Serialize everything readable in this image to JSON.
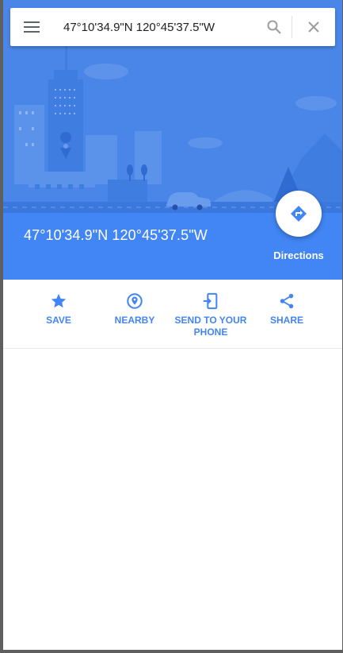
{
  "search": {
    "query": "47°10'34.9\"N 120°45'37.5\"W",
    "menu_icon": "hamburger-menu-icon",
    "search_icon": "magnifier-icon",
    "close_icon": "close-icon"
  },
  "place": {
    "title": "47°10'34.9\"N 120°45'37.5\"W",
    "directions_label": "Directions"
  },
  "actions": [
    {
      "label": "SAVE",
      "icon": "star-icon"
    },
    {
      "label": "NEARBY",
      "icon": "location-pin-icon"
    },
    {
      "label": "SEND TO YOUR PHONE",
      "icon": "send-to-phone-icon"
    },
    {
      "label": "SHARE",
      "icon": "share-icon"
    }
  ],
  "colors": {
    "accent": "#4285f4",
    "header_bg": "#4285f4",
    "panel_bg": "#ffffff"
  }
}
